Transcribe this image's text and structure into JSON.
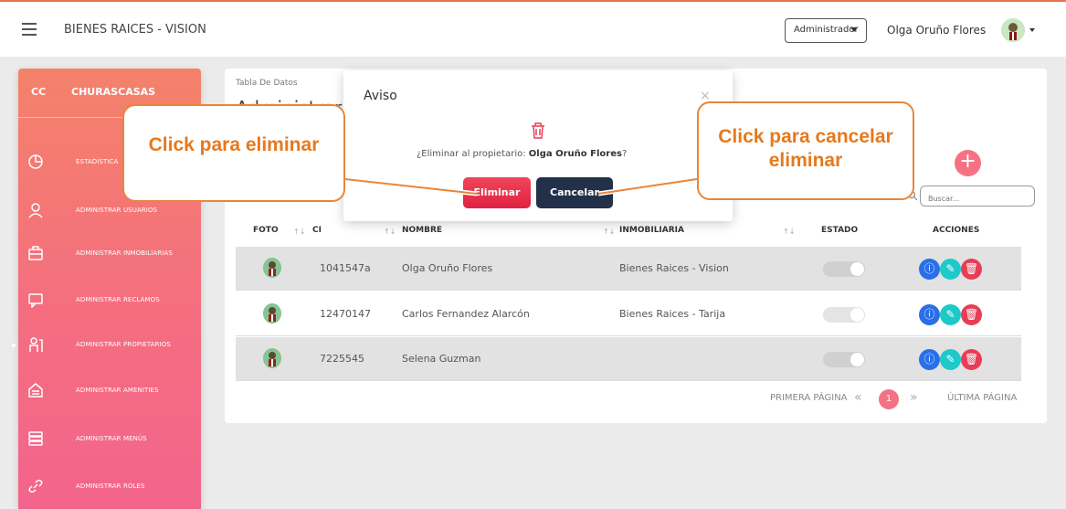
{
  "header": {
    "app_title": "BIENES RAICES - VISION",
    "role_selected": "Administrador",
    "user_name": "Olga Oruño Flores"
  },
  "sidebar": {
    "brand_abbr": "CC",
    "brand_name": "CHURASCASAS",
    "items": [
      {
        "label": "ESTADÍSTICA",
        "icon": "pie-chart-icon"
      },
      {
        "label": "ADMINISTRAR USUARIOS",
        "icon": "user-icon"
      },
      {
        "label": "ADMINISTRAR INMOBILIARIAS",
        "icon": "briefcase-icon"
      },
      {
        "label": "ADMINISTRAR RECLAMOS",
        "icon": "chat-icon"
      },
      {
        "label": "ADMINISTRAR PROPIETARIOS",
        "icon": "owner-icon",
        "active": true
      },
      {
        "label": "ADMINISTRAR AMENITIES",
        "icon": "garage-icon"
      },
      {
        "label": "ADMINISTRAR MENÚS",
        "icon": "menu-stack-icon"
      },
      {
        "label": "ADMINISTRAR ROLES",
        "icon": "link-icon"
      }
    ]
  },
  "main": {
    "subtitle": "Tabla De Datos",
    "title": "Administrar Propietarios",
    "search_placeholder": "Buscar...",
    "table": {
      "headers": [
        "FOTO",
        "CI",
        "NOMBRE",
        "INMOBILIARIA",
        "ESTADO",
        "ACCIONES"
      ],
      "rows": [
        {
          "ci": "1041547a",
          "nombre": "Olga Oruño Flores",
          "inmobiliaria": "Bienes Raices - Vision",
          "estado": true
        },
        {
          "ci": "12470147",
          "nombre": "Carlos Fernandez Alarcón",
          "inmobiliaria": "Bienes Raices - Tarija",
          "estado": true
        },
        {
          "ci": "7225545",
          "nombre": "Selena Guzman",
          "inmobiliaria": "",
          "estado": true
        }
      ]
    },
    "pagination": {
      "first": "PRIMERA PÁGINA",
      "current": "1",
      "last": "ÚLTIMA PÁGINA"
    }
  },
  "modal": {
    "title": "Aviso",
    "message_prefix": "¿Eliminar al propietario: ",
    "message_name": "Olga Oruño Flores",
    "message_suffix": "?",
    "confirm_label": "Eliminar",
    "cancel_label": "Cancelar"
  },
  "callouts": {
    "left": "Click para eliminar",
    "right": "Click para cancelar eliminar"
  },
  "colors": {
    "accent": "#f47284",
    "callout": "#e6791d",
    "delete": "#e83e55",
    "cancel": "#223049"
  }
}
